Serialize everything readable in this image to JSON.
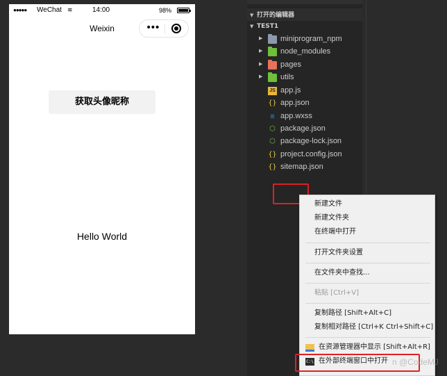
{
  "phone": {
    "carrier": "WeChat",
    "time": "14:00",
    "battery_pct": "98%",
    "battery_level": 0.98,
    "nav_title": "Weixin",
    "profile_button": "获取头像昵称",
    "hello_text": "Hello World"
  },
  "explorer": {
    "open_editors": "打开的编辑器",
    "project": "TEST1",
    "items": [
      {
        "label": "miniprogram_npm",
        "icon": "folder-icon"
      },
      {
        "label": "node_modules",
        "icon": "folder-icon"
      },
      {
        "label": "pages",
        "icon": "folder-icon"
      },
      {
        "label": "utils",
        "icon": "folder-icon"
      },
      {
        "label": "app.js",
        "icon": "js-file-icon"
      },
      {
        "label": "app.json",
        "icon": "json-file-icon"
      },
      {
        "label": "app.wxss",
        "icon": "wxss-file-icon"
      },
      {
        "label": "package.json",
        "icon": "package-file-icon"
      },
      {
        "label": "package-lock.json",
        "icon": "package-file-icon"
      },
      {
        "label": "project.config.json",
        "icon": "json-file-icon"
      },
      {
        "label": "sitemap.json",
        "icon": "json-file-icon"
      }
    ]
  },
  "context_menu": {
    "items": [
      "新建文件",
      "新建文件夹",
      "在终端中打开",
      "打开文件夹设置",
      "在文件夹中查找...",
      "粘贴 [Ctrl+V]",
      "复制路径 [Shift+Alt+C]",
      "复制相对路径 [Ctrl+K Ctrl+Shift+C]",
      "在资源管理器中显示 [Shift+Alt+R]",
      "在外部终端窗口中打开"
    ]
  },
  "watermark": "n @CodeMJ",
  "colors": {
    "folder_npm": "#8c9bab",
    "folder_node": "#6fbf3a",
    "folder_pages": "#e8725a",
    "folder_utils": "#6fbf3a",
    "highlight": "#e02020"
  }
}
